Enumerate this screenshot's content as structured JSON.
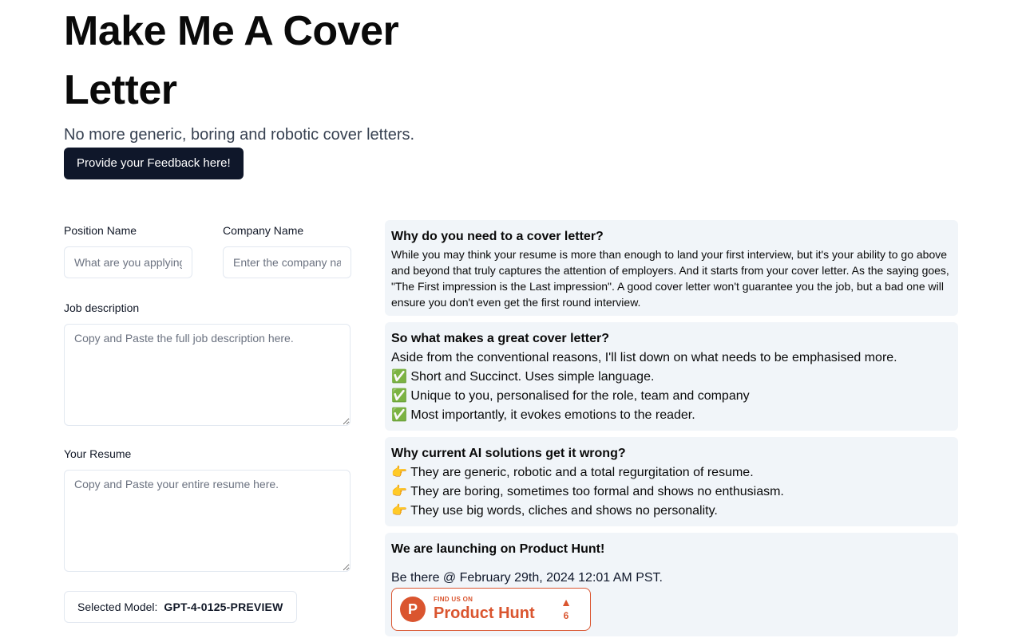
{
  "hero": {
    "title_line1": "Make Me A Cover",
    "title_line2": "Letter",
    "subtitle": "No more generic, boring and robotic cover letters.",
    "feedback_button": "Provide your Feedback here!"
  },
  "form": {
    "position_label": "Position Name",
    "position_placeholder": "What are you applying for?",
    "company_label": "Company Name",
    "company_placeholder": "Enter the company name",
    "jd_label": "Job description",
    "jd_placeholder": "Copy and Paste the full job description here.",
    "resume_label": "Your Resume",
    "resume_placeholder": "Copy and Paste your entire resume here.",
    "model_label": "Selected Model:",
    "model_value": "GPT-4-0125-PREVIEW"
  },
  "cards": {
    "why": {
      "title": "Why do you need to a cover letter?",
      "body": "While you may think your resume is more than enough to land your first interview, but it's your ability to go above and beyond that truly captures the attention of employers. And it starts from your cover letter. As the saying goes, \"The First impression is the Last impression\". A good cover letter won't guarantee you the job, but a bad one will ensure you don't even get the first round interview."
    },
    "great": {
      "title": "So what makes a great cover letter?",
      "intro": "Aside from the conventional reasons, I'll list down on what needs to be emphasised more.",
      "items": [
        "✅ Short and Succinct. Uses simple language.",
        "✅ Unique to you, personalised for the role, team and company",
        "✅ Most importantly, it evokes emotions to the reader."
      ]
    },
    "wrong": {
      "title": "Why current AI solutions get it wrong?",
      "items": [
        "👉 They are generic, robotic and a total regurgitation of resume.",
        "👉 They are boring, sometimes too formal and shows no enthusiasm.",
        "👉 They use big words, cliches and shows no personality."
      ]
    },
    "launch": {
      "title": "We are launching on Product Hunt!",
      "date": "Be there @ February 29th, 2024 12:01 AM PST."
    }
  },
  "product_hunt": {
    "logo_letter": "P",
    "small": "FIND US ON",
    "big": "Product Hunt",
    "arrow": "▲",
    "count": "6"
  }
}
